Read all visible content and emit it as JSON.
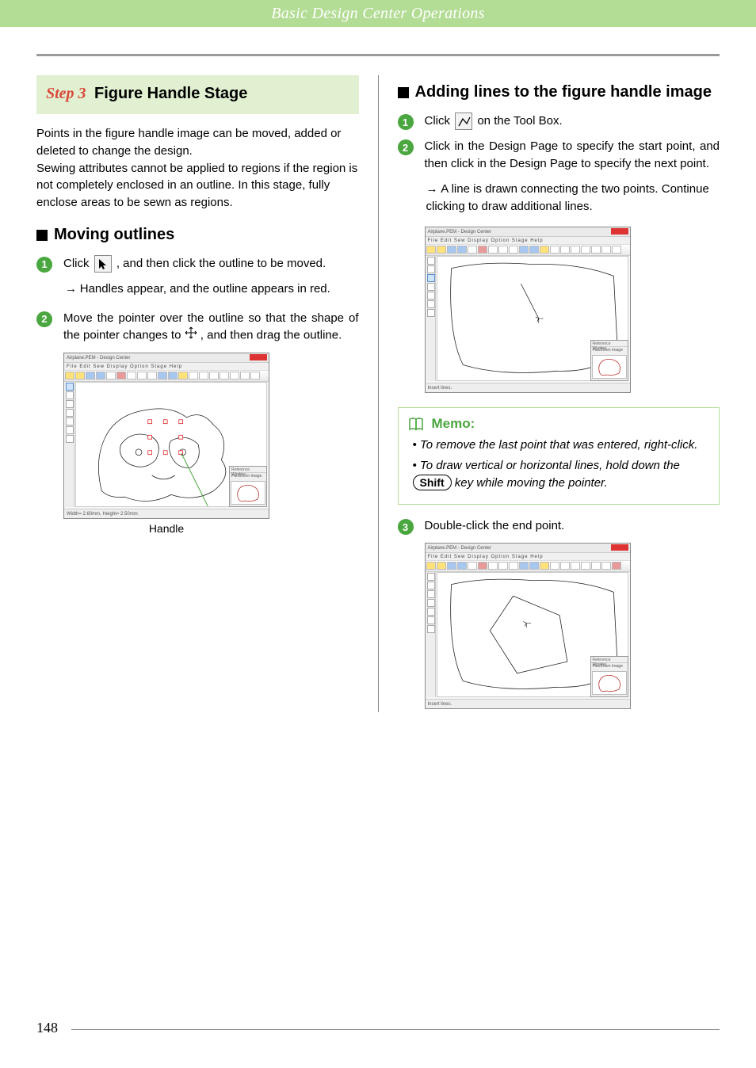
{
  "header": "Basic Design Center Operations",
  "step": {
    "label": "Step 3",
    "title": "Figure Handle Stage"
  },
  "intro": "Points in the figure handle image can be moved, added or deleted to change the design.\nSewing attributes cannot be applied to regions if the region is not completely enclosed in an outline. In this stage, fully enclose areas to be sewn as regions.",
  "left": {
    "subhead": "Moving outlines",
    "item1_a": "Click ",
    "item1_b": ", and then click the outline to be moved.",
    "arrow1": "Handles appear, and the outline appears in red.",
    "item2_a": "Move the pointer over the outline so that the shape of the pointer changes to ",
    "item2_b": ", and then drag the outline.",
    "caption1": "Handle"
  },
  "right": {
    "subhead": "Adding lines to the figure handle image",
    "item1_a": "Click ",
    "item1_b": " on the Tool Box.",
    "item2": "Click in the Design Page to specify the start point, and then click in the Design Page to specify the next point.",
    "arrow2": "A line is drawn connecting the two points. Continue clicking to draw additional lines.",
    "memo_title": "Memo:",
    "memo1": "To remove the last point that was entered, right-click.",
    "memo2_a": "To draw vertical or horizontal lines, hold down the ",
    "memo2_key": "Shift",
    "memo2_b": " key while moving the pointer.",
    "item3": "Double-click the end point."
  },
  "screenshots": {
    "app_title": "Airplane.PEM - Design Center",
    "menubar": "File  Edit  Sew  Display  Option  Stage  Help",
    "status1": "Width= 2.60mm, Height= 2.50mm",
    "status2": "Insert lines.",
    "ref_title": "Reference Window",
    "ref_tabs": "Pan/Zoom  Image"
  },
  "page_number": "148"
}
